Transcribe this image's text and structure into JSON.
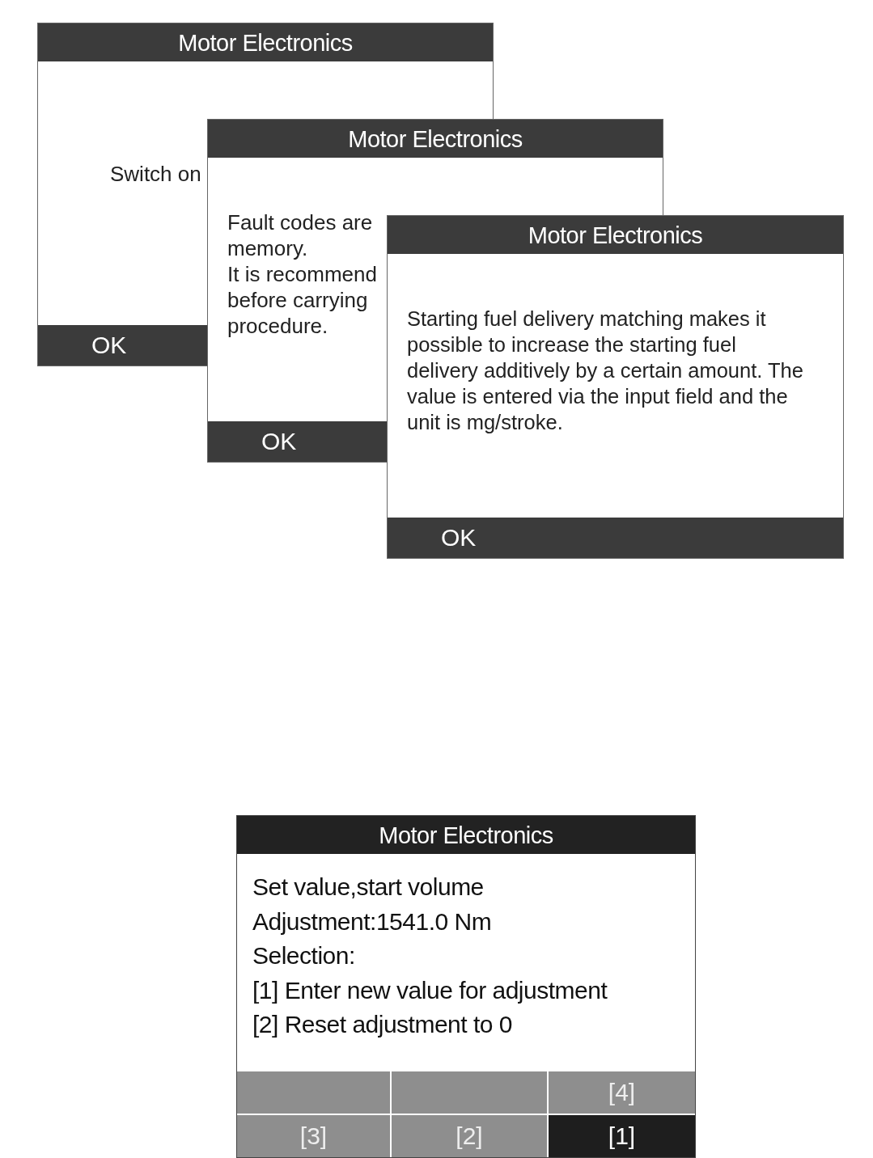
{
  "dialogs": [
    {
      "title": "Motor Electronics",
      "lines": [
        "Switch on"
      ],
      "button": "OK"
    },
    {
      "title": "Motor Electronics",
      "lines": [
        "Fault codes are",
        "memory.",
        "It is recommend",
        "before carrying",
        "procedure."
      ],
      "button": "OK"
    },
    {
      "title": "Motor Electronics",
      "lines": [
        "Starting fuel delivery matching makes it possible to increase the starting fuel delivery additively by a certain amount. The value is entered via the input field and the unit is mg/stroke."
      ],
      "button": "OK"
    }
  ],
  "screen": {
    "title": "Motor Electronics",
    "lines": [
      "Set value,start volume",
      "Adjustment:1541.0 Nm",
      "Selection:",
      "[1] Enter new value for adjustment",
      "[2] Reset adjustment to 0"
    ],
    "soft_keys": [
      [
        {
          "selected": false
        },
        {
          "selected": false
        },
        {
          "label": "[4]",
          "selected": false
        }
      ],
      [
        {
          "label": "[3]",
          "selected": false
        },
        {
          "label": "[2]",
          "selected": false
        },
        {
          "label": "[1]",
          "selected": true
        }
      ]
    ]
  }
}
